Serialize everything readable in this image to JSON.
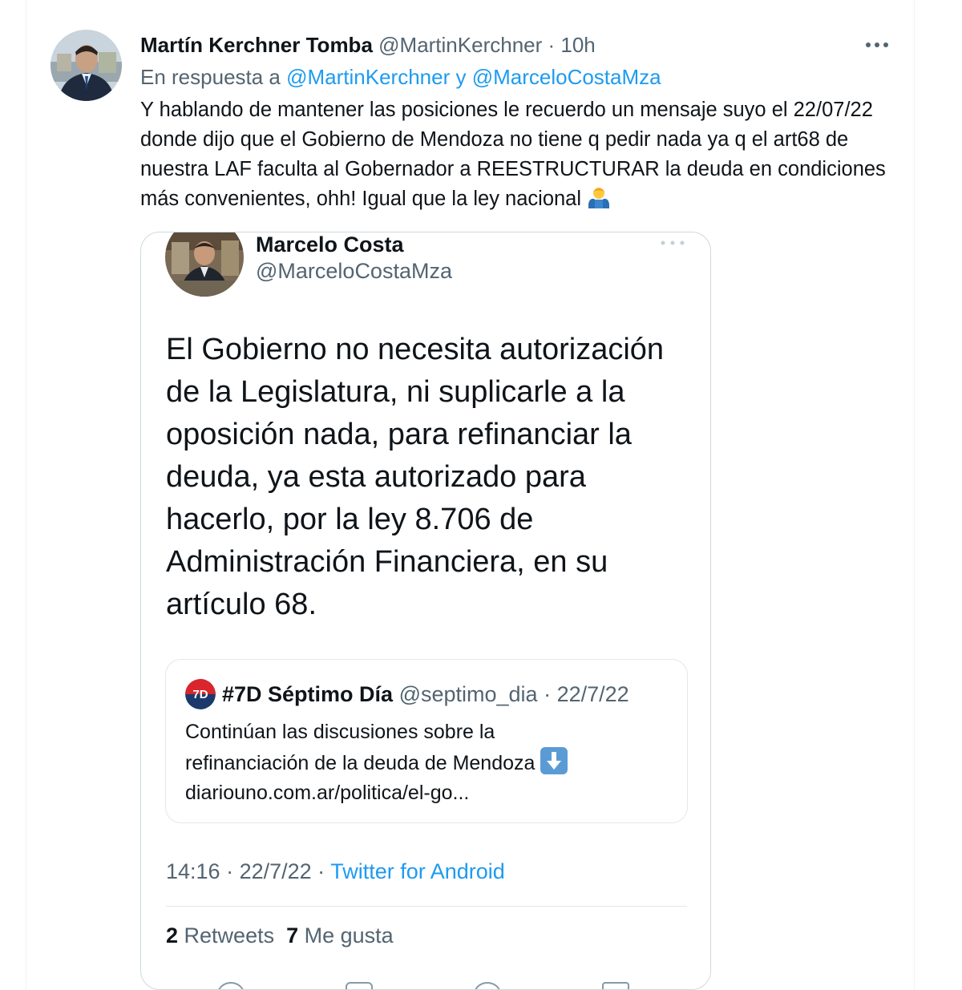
{
  "tweet": {
    "author_name": "Martín Kerchner Tomba",
    "author_handle": "@MartinKerchner",
    "time_sep": " · ",
    "time": "10h",
    "reply_prefix": "En respuesta a ",
    "reply_mentions": "@MartinKerchner y @MarceloCostaMza",
    "text": "Y hablando de mantener las posiciones le recuerdo un mensaje suyo el 22/07/22 donde dijo que el Gobierno de Mendoza no tiene q pedir nada ya q el art68 de nuestra LAF faculta al Gobernador a REESTRUCTURAR la deuda en condiciones más convenientes, ohh! Igual que la ley nacional",
    "more_icon": "more-horizontal-icon",
    "trailing_emoji": "man-shrugging-emoji"
  },
  "quoted_screenshot": {
    "author_name": "Marcelo Costa",
    "author_handle": "@MarceloCostaMza",
    "text": "El Gobierno no necesita autorización de la Legislatura, ni suplicarle a la oposición nada, para refinanciar la deuda, ya esta autorizado para hacerlo, por la ley 8.706 de Administración Financiera, en su artículo 68.",
    "inner_quote": {
      "author_name": "#7D Séptimo Día",
      "author_handle": "@septimo_dia",
      "date_sep": " · ",
      "date": "22/7/22",
      "text_line1": "Continúan las discusiones sobre la",
      "text_line2": "refinanciación de la deuda de Mendoza",
      "link": "diariouno.com.ar/politica/el-go...",
      "arrow_icon": "down-arrow-icon"
    },
    "meta": {
      "time": "14:16",
      "sep1": " · ",
      "date": "22/7/22",
      "sep2": " · ",
      "source": "Twitter for Android"
    },
    "stats": {
      "retweets_count": "2",
      "retweets_label": " Retweets",
      "likes_count": "7",
      "likes_label": " Me gusta"
    }
  },
  "colors": {
    "link": "#1d9bf0",
    "secondary_text": "#536471",
    "primary_text": "#0f1419",
    "border": "#cfd9de"
  }
}
